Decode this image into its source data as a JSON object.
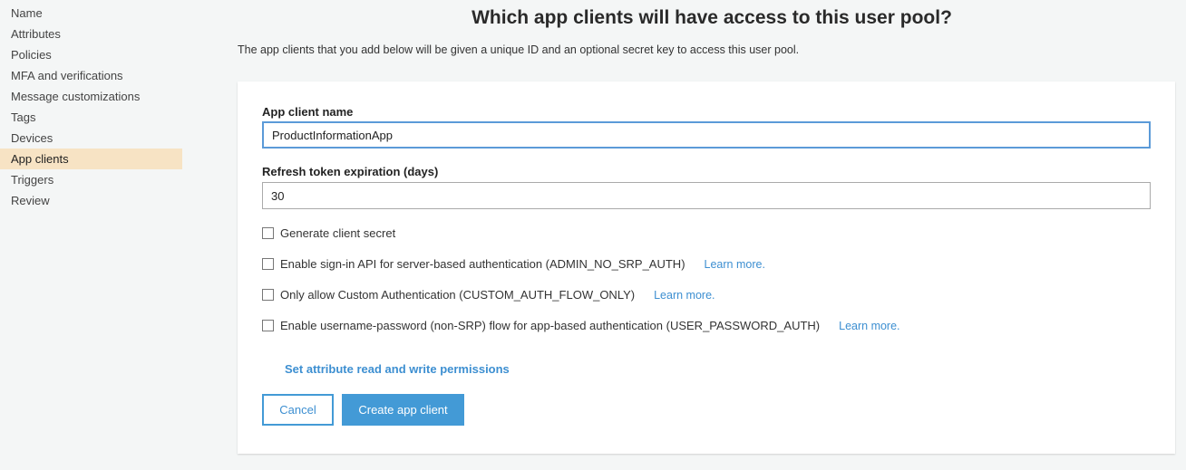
{
  "sidebar": {
    "items": [
      {
        "label": "Name"
      },
      {
        "label": "Attributes"
      },
      {
        "label": "Policies"
      },
      {
        "label": "MFA and verifications"
      },
      {
        "label": "Message customizations"
      },
      {
        "label": "Tags"
      },
      {
        "label": "Devices"
      },
      {
        "label": "App clients",
        "active": true
      },
      {
        "label": "Triggers"
      },
      {
        "label": "Review"
      }
    ]
  },
  "header": {
    "title": "Which app clients will have access to this user pool?",
    "subtitle": "The app clients that you add below will be given a unique ID and an optional secret key to access this user pool."
  },
  "form": {
    "client_name_label": "App client name",
    "client_name_value": "ProductInformationApp",
    "refresh_label": "Refresh token expiration (days)",
    "refresh_value": "30",
    "checkboxes": [
      {
        "label": "Generate client secret",
        "checked": false
      },
      {
        "label": "Enable sign-in API for server-based authentication (ADMIN_NO_SRP_AUTH)",
        "checked": false,
        "link": "Learn more."
      },
      {
        "label": "Only allow Custom Authentication (CUSTOM_AUTH_FLOW_ONLY)",
        "checked": false,
        "link": "Learn more."
      },
      {
        "label": "Enable username-password (non-SRP) flow for app-based authentication (USER_PASSWORD_AUTH)",
        "checked": false,
        "link": "Learn more."
      }
    ],
    "permissions_link": "Set attribute read and write permissions",
    "cancel_label": "Cancel",
    "create_label": "Create app client"
  },
  "colors": {
    "accent": "#439ad6",
    "active_nav": "#f7e3c4"
  }
}
